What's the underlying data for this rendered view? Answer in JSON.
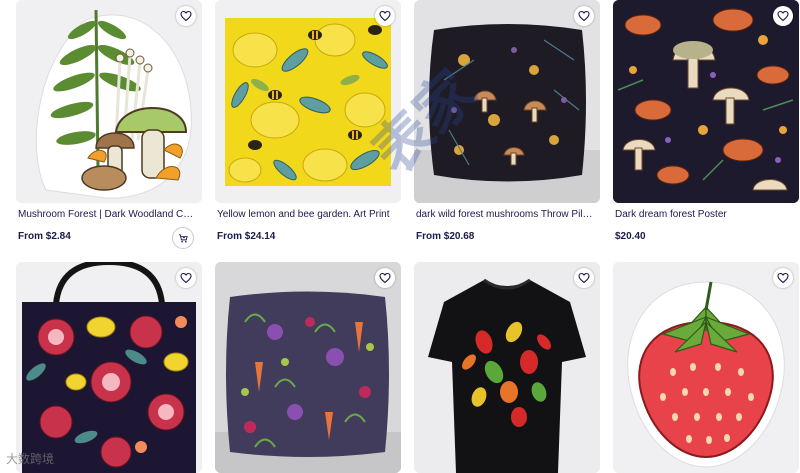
{
  "products": [
    {
      "title": "Mushroom Forest | Dark Woodland Cottagecore Mushrooms Sticker",
      "price": "From $2.84",
      "thumb_icon": "mushroom-sticker-art"
    },
    {
      "title": "Yellow lemon and bee garden. Art Print",
      "price": "From $24.14",
      "thumb_icon": "lemon-bee-art"
    },
    {
      "title": "dark wild forest mushrooms Throw Pillow",
      "price": "From $20.68",
      "thumb_icon": "mushroom-pillow-art"
    },
    {
      "title": "Dark dream forest Poster",
      "price": "$20.40",
      "thumb_icon": "mushroom-poster-art"
    },
    {
      "thumb_icon": "pomegranate-tote-art"
    },
    {
      "thumb_icon": "vegetable-pillow-art"
    },
    {
      "thumb_icon": "pepper-tshirt-art"
    },
    {
      "thumb_icon": "strawberry-sticker-art"
    }
  ],
  "watermark": "表家",
  "watermark_logo": "大数跨境",
  "colors": {
    "text": "#1a1a4b",
    "sticker_bg": "#f0f0f2",
    "lemon_bg": "#f2d81a",
    "dark_pattern": "#1e1a2e"
  }
}
